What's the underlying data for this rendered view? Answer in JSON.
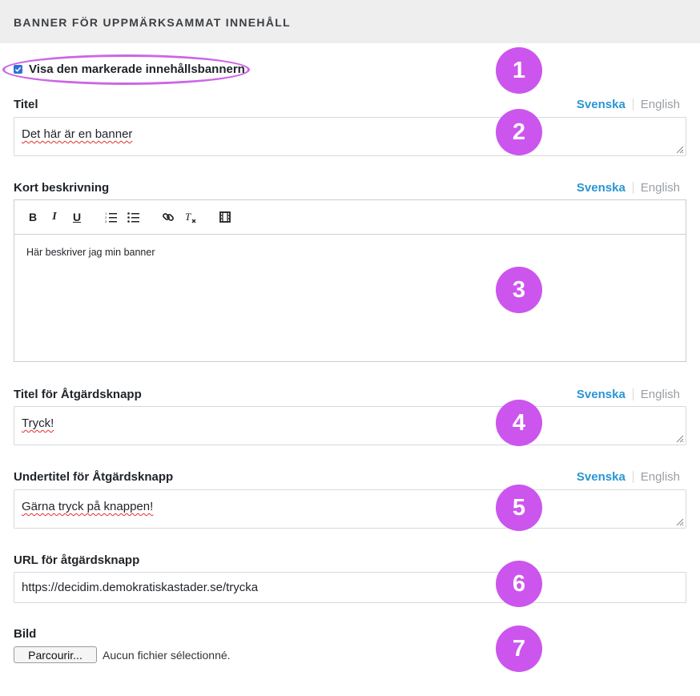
{
  "section_title": "BANNER FÖR UPPMÄRKSAMMAT INNEHÅLL",
  "show_banner": {
    "label": "Visa den markerade innehållsbannern",
    "checked": true
  },
  "languages": {
    "active": "Svenska",
    "inactive": "English"
  },
  "title_field": {
    "label": "Titel",
    "value": "Det här är en banner"
  },
  "short_description": {
    "label": "Kort beskrivning",
    "toolbar": [
      "bold-icon",
      "italic-icon",
      "underline-icon",
      "ordered-list-icon",
      "bullet-list-icon",
      "link-icon",
      "clear-format-icon",
      "video-icon"
    ],
    "value": "Här beskriver jag min banner"
  },
  "action_button_title": {
    "label": "Titel för Åtgärdsknapp",
    "value": "Tryck!"
  },
  "action_button_subtitle": {
    "label": "Undertitel för Åtgärdsknapp",
    "value": "Gärna tryck på knappen!"
  },
  "action_button_url": {
    "label": "URL för åtgärdsknapp",
    "value": "https://decidim.demokratiskastader.se/trycka"
  },
  "image_field": {
    "label": "Bild",
    "button": "Parcourir...",
    "status": "Aucun fichier sélectionné."
  },
  "badges": [
    "1",
    "2",
    "3",
    "4",
    "5",
    "6",
    "7"
  ],
  "colors": {
    "accent": "#2a96d3",
    "badge": "#cc55ee",
    "checkbox": "#2f6fd6"
  }
}
